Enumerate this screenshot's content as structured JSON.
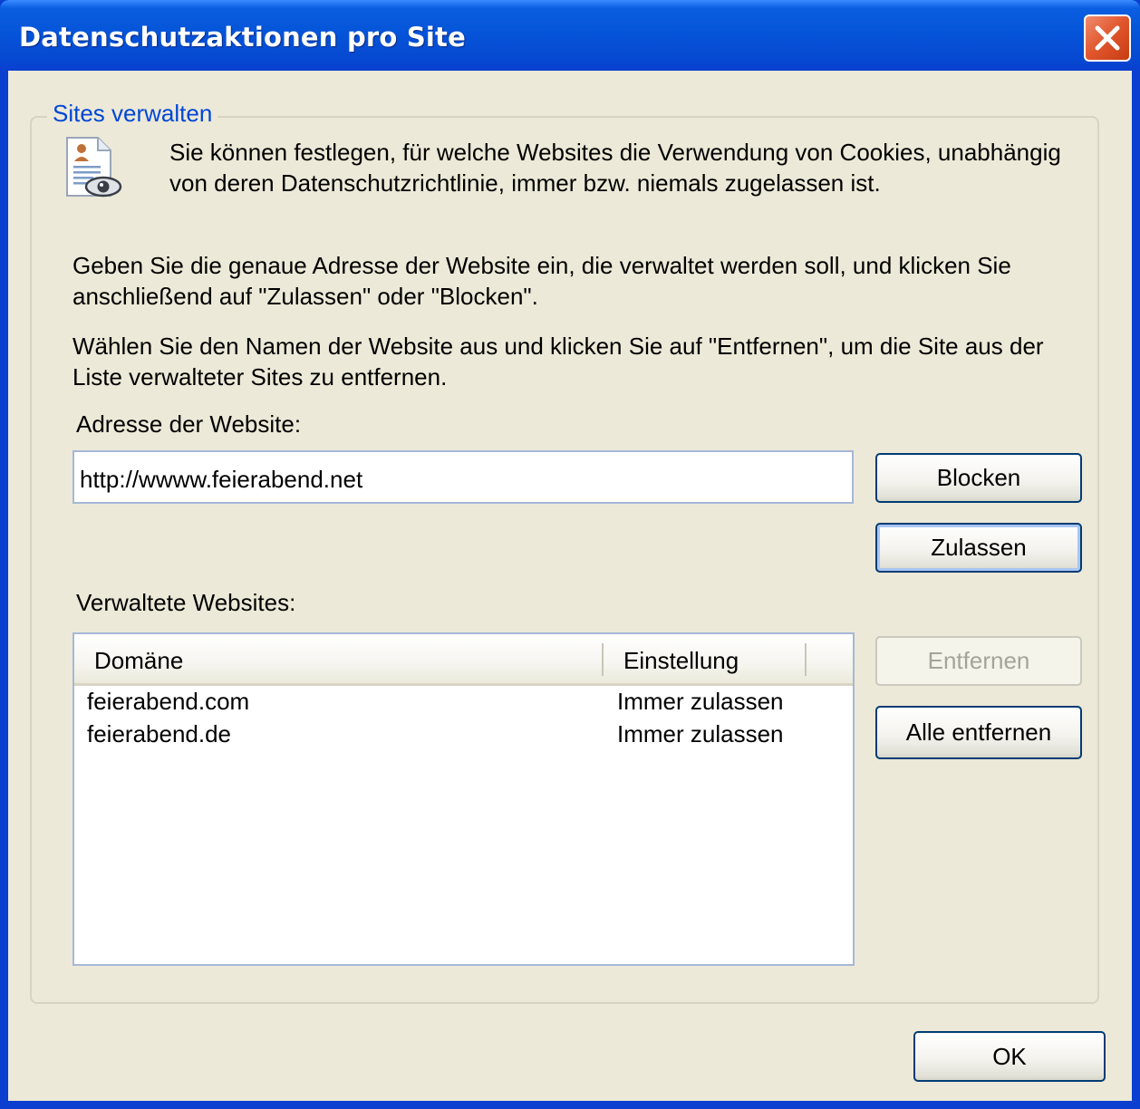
{
  "window": {
    "title": "Datenschutzaktionen pro Site"
  },
  "group": {
    "legend": "Sites verwalten",
    "description": "Sie können festlegen, für welche Websites die Verwendung von Cookies, unabhängig von deren Datenschutzrichtlinie, immer bzw. niemals zugelassen ist.",
    "instruction_add": "Geben Sie die genaue Adresse der Website ein, die verwaltet werden soll, und klicken Sie anschließend auf \"Zulassen\" oder \"Blocken\".",
    "instruction_remove": "Wählen Sie den Namen der Website aus und klicken Sie auf \"Entfernen\", um die Site aus der Liste verwalteter Sites zu entfernen."
  },
  "address": {
    "label": "Adresse der Website:",
    "value": "http://wwww.feierabend.net"
  },
  "buttons": {
    "block": "Blocken",
    "allow": "Zulassen",
    "remove": "Entfernen",
    "remove_all": "Alle entfernen",
    "ok": "OK"
  },
  "managed": {
    "label": "Verwaltete Websites:",
    "columns": [
      "Domäne",
      "Einstellung"
    ],
    "rows": [
      {
        "domain": "feierabend.com",
        "setting": "Immer zulassen"
      },
      {
        "domain": "feierabend.de",
        "setting": "Immer zulassen"
      }
    ]
  },
  "icons": {
    "close": "close-icon",
    "info": "privacy-report-icon"
  },
  "colors": {
    "titlebar": "#0553d8",
    "window_bg": "#ece9d8",
    "legend": "#0046d5",
    "close": "#e0552c"
  }
}
